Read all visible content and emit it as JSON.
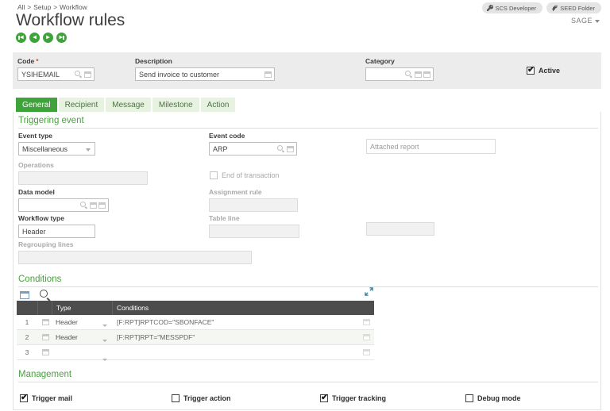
{
  "header": {
    "breadcrumb": {
      "items": [
        "All",
        "Setup",
        "Workflow"
      ],
      "separator": ">"
    },
    "title": "Workflow rules",
    "profile_buttons": [
      {
        "label": "SCS Developer",
        "icon": "key-icon"
      },
      {
        "label": "SEED Folder",
        "icon": "plug-icon"
      }
    ],
    "user_menu_label": "SAGE",
    "nav": {
      "first": "◀",
      "prev": "◀",
      "next": "▶",
      "last": "▶"
    }
  },
  "record_bar": {
    "code": {
      "label": "Code",
      "required_mark": "*",
      "value": "YSIHEMAIL"
    },
    "description": {
      "label": "Description",
      "value": "Send invoice to customer"
    },
    "category": {
      "label": "Category",
      "value": ""
    },
    "active": {
      "label": "Active",
      "glyph": "✔"
    }
  },
  "tabs": [
    {
      "label": "General",
      "active": true
    },
    {
      "label": "Recipient",
      "active": false
    },
    {
      "label": "Message",
      "active": false
    },
    {
      "label": "Milestone",
      "active": false
    },
    {
      "label": "Action",
      "active": false
    }
  ],
  "triggering_event": {
    "title": "Triggering event",
    "event_type": {
      "label": "Event type",
      "value": "Miscellaneous"
    },
    "event_code": {
      "label": "Event code",
      "value": "ARP"
    },
    "attached_report": {
      "placeholder": "Attached report",
      "value": ""
    },
    "operations": {
      "label": "Operations",
      "value": ""
    },
    "end_of_transaction": {
      "label": "End of transaction",
      "glyph": ""
    },
    "data_model": {
      "label": "Data model",
      "value": ""
    },
    "assignment_rule": {
      "label": "Assignment rule",
      "value": ""
    },
    "workflow_type": {
      "label": "Workflow type",
      "value": "Header"
    },
    "table_line": {
      "label": "Table line",
      "value": ""
    },
    "regrouping_lines": {
      "label": "Regrouping lines",
      "value": ""
    }
  },
  "conditions": {
    "title": "Conditions",
    "columns": [
      "Type",
      "Conditions"
    ],
    "rows": [
      {
        "num": "1",
        "type": "Header",
        "condition": "[F:RPT]RPTCOD=\"SBONFACE\""
      },
      {
        "num": "2",
        "type": "Header",
        "condition": "[F:RPT]RPT=\"MESSPDF\""
      },
      {
        "num": "3",
        "type": "",
        "condition": ""
      }
    ]
  },
  "management": {
    "title": "Management",
    "checkboxes": [
      {
        "label": "Trigger mail",
        "glyph": "✔"
      },
      {
        "label": "Trigger action",
        "glyph": ""
      },
      {
        "label": "Trigger tracking",
        "glyph": "✔"
      },
      {
        "label": "Debug mode",
        "glyph": ""
      }
    ]
  }
}
